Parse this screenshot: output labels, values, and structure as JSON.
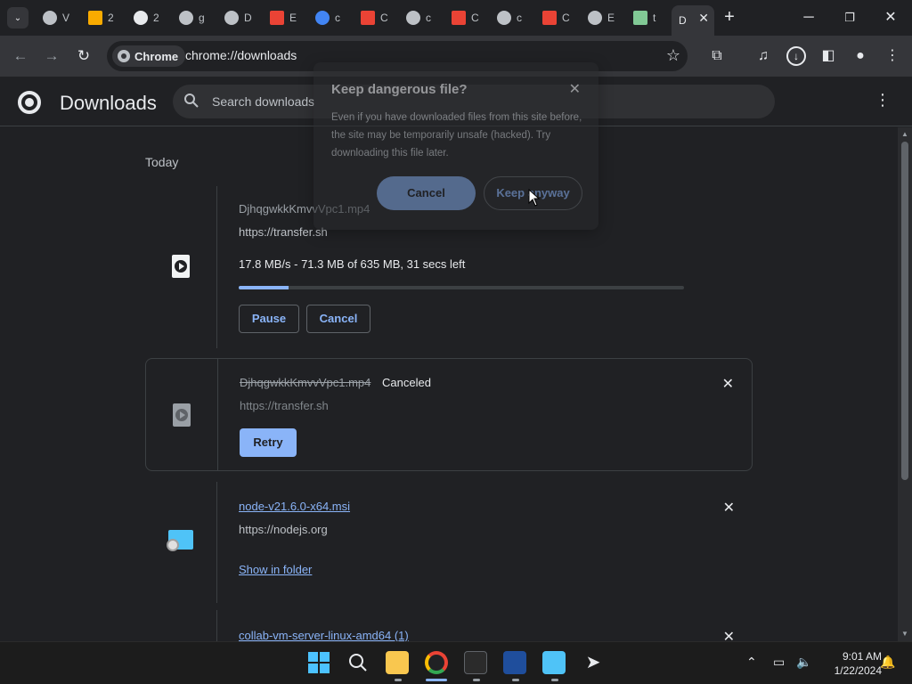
{
  "tabs": [
    {
      "fav_color": "#bdc1c6",
      "label": "V"
    },
    {
      "fav_color": "#f9ab00",
      "label": "2"
    },
    {
      "fav_color": "#e8eaed",
      "label": "2"
    },
    {
      "fav_color": "#bdc1c6",
      "label": "g"
    },
    {
      "fav_color": "#bdc1c6",
      "label": "D"
    },
    {
      "fav_color": "#ea4335",
      "label": "E"
    },
    {
      "fav_color": "#4285f4",
      "label": "c"
    },
    {
      "fav_color": "#ea4335",
      "label": "C"
    },
    {
      "fav_color": "#bdc1c6",
      "label": "c"
    },
    {
      "fav_color": "#ea4335",
      "label": "C"
    },
    {
      "fav_color": "#bdc1c6",
      "label": "c"
    },
    {
      "fav_color": "#ea4335",
      "label": "C"
    },
    {
      "fav_color": "#bdc1c6",
      "label": "E"
    },
    {
      "fav_color": "#81c995",
      "label": "t"
    }
  ],
  "active_tab": {
    "label": "D"
  },
  "window_controls": {
    "minimize": "─",
    "restore": "❐",
    "close": "✕"
  },
  "toolbar": {
    "chip_label": "Chrome",
    "url": "chrome://downloads"
  },
  "downloads_page": {
    "title": "Downloads",
    "search_placeholder": "Search downloads"
  },
  "section_label": "Today",
  "items": [
    {
      "filename": "DjhqgwkkKmvvVpc1.mp4",
      "source": "https://transfer.sh",
      "status": "17.8 MB/s - 71.3 MB of 635 MB, 31 secs left",
      "progress": 0.112,
      "pause_label": "Pause",
      "cancel_label": "Cancel"
    },
    {
      "filename": "DjhqgwkkKmvvVpc1.mp4",
      "state": "Canceled",
      "source": "https://transfer.sh",
      "retry_label": "Retry"
    },
    {
      "filename": "node-v21.6.0-x64.msi",
      "source": "https://nodejs.org",
      "show_label": "Show in folder"
    },
    {
      "filename": "collab-vm-server-linux-amd64 (1)"
    }
  ],
  "dialog": {
    "title": "Keep dangerous file?",
    "body": "Even if you have downloaded files from this site before, the site may be temporarily unsafe (hacked). Try downloading this file later.",
    "cancel_label": "Cancel",
    "keep_label": "Keep anyway"
  },
  "clock": {
    "time": "9:01 AM",
    "date": "1/22/2024"
  },
  "colors": {
    "accent": "#8ab4f8",
    "background": "#202124",
    "toolbar": "#35363a"
  }
}
